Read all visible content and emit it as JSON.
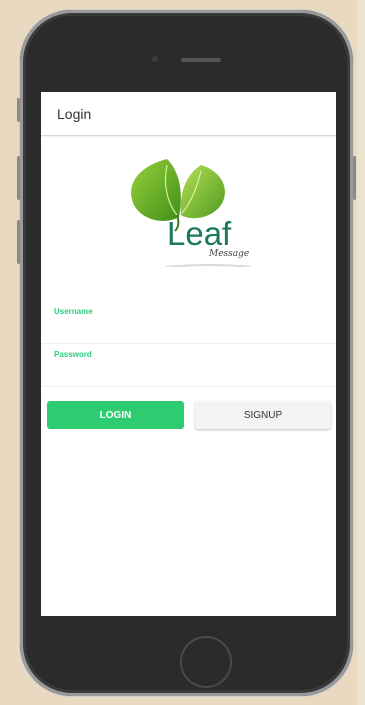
{
  "header": {
    "title": "Login"
  },
  "logo": {
    "name": "Leaf",
    "tagline": "Message"
  },
  "form": {
    "username": {
      "label": "Username",
      "value": ""
    },
    "password": {
      "label": "Password",
      "value": ""
    }
  },
  "buttons": {
    "login": "LOGIN",
    "signup": "SIGNUP"
  },
  "colors": {
    "accent": "#2ecc71",
    "label": "#2fcf7d",
    "logo_text": "#1a7a53",
    "leaf": "#7fbf2a"
  }
}
